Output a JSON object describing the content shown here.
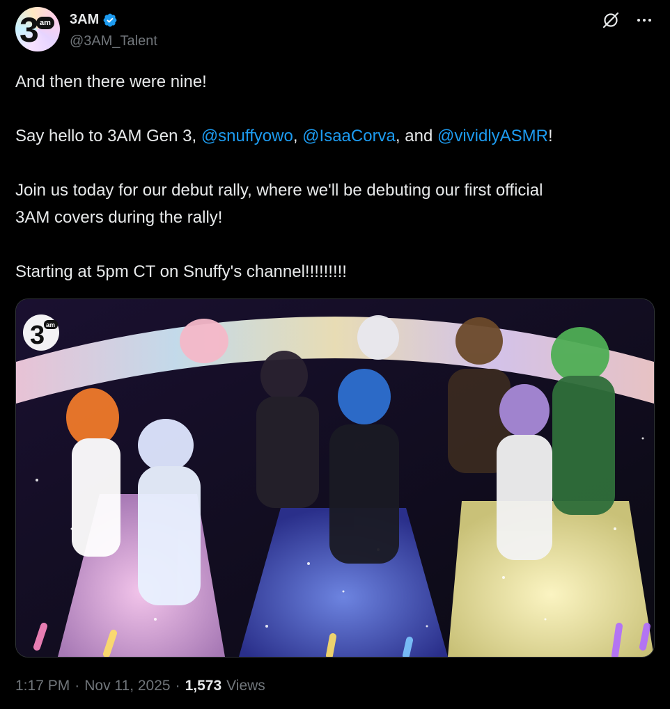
{
  "header": {
    "display_name": "3AM",
    "handle": "@3AM_Talent",
    "avatar_text": "3",
    "avatar_badge": "am",
    "verified_color": "#1d9bf0",
    "icons": [
      "grok-icon",
      "more-options-icon"
    ]
  },
  "tweet": {
    "line1": "And then there were nine!",
    "line2": {
      "prefix": "Say hello to 3AM Gen 3, ",
      "mention1": "@snuffyowo",
      "sep1": ", ",
      "mention2": "@IsaaCorva",
      "sep2": ", and ",
      "mention3": "@vividlyASMR",
      "suffix": "!"
    },
    "line3a": "Join us today for our debut rally, where we'll be debuting our first official",
    "line3b": "3AM covers during the rally!",
    "line4": "Starting at 5pm CT on Snuffy's channel!!!!!!!!!",
    "mention_color": "#1d9bf0"
  },
  "media": {
    "logo_text": "3",
    "logo_badge": "am",
    "description_icon": "group-illustration-image"
  },
  "meta": {
    "time": "1:17 PM",
    "dot1": "·",
    "date": "Nov 11, 2025",
    "dot2": "·",
    "views_count": "1,573",
    "views_label": "Views"
  }
}
